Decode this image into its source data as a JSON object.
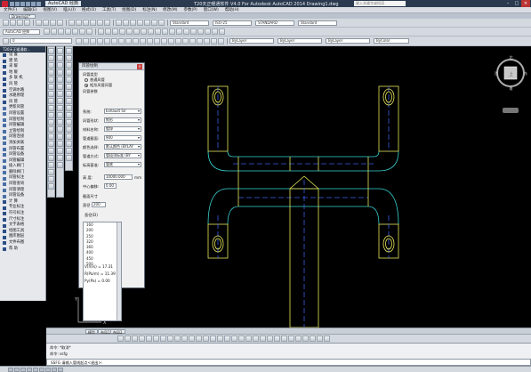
{
  "titlebar": {
    "workspace": "AutoCAD 经典",
    "title": "T20天正暖通软件 V4.0 For Autodesk AutoCAD 2014    Drawing1.dwg",
    "search_placeholder": "键入关键字或短语"
  },
  "menu": [
    "文件(F)",
    "编辑(E)",
    "视图(V)",
    "插入(I)",
    "格式(O)",
    "工具(T)",
    "绘图(D)",
    "标注(N)",
    "修改(M)",
    "参数(P)",
    "窗口(W)",
    "帮助(H)"
  ],
  "file_tab": "Drawing1*",
  "toolbar2": {
    "workspace": "AutoCAD 经典",
    "style1": "Standard",
    "style2": "ISO-25",
    "style3": "STANDARD",
    "style4": "Standard"
  },
  "toolbar3": {
    "layer": "0",
    "color": "ByLayer",
    "linetype": "ByLayer",
    "lineweight": "ByLayer",
    "plotstyle": "ByColor"
  },
  "palette": {
    "title": "T20天正暖通软...",
    "items": [
      {
        "label": "设    置",
        "group": true
      },
      {
        "label": "建    筑",
        "group": true
      },
      {
        "label": "采    暖",
        "group": true
      },
      {
        "label": "地    暖",
        "group": true
      },
      {
        "label": "多 联 机",
        "group": true
      },
      {
        "label": "风    管",
        "group": true
      },
      {
        "label": "空调水路",
        "group": true
      },
      {
        "label": "水路原理",
        "group": true
      },
      {
        "label": "风    管",
        "group": true
      },
      {
        "label": "更新风管",
        "group": false
      },
      {
        "label": "风管设置",
        "group": false
      },
      {
        "label": "风管绘制",
        "group": false
      },
      {
        "label": "风管编辑",
        "group": false
      },
      {
        "label": "立管绘制",
        "group": false
      },
      {
        "label": "风管连接",
        "group": false
      },
      {
        "label": "添加关联",
        "group": false
      },
      {
        "label": "风管布置",
        "group": false
      },
      {
        "label": "风管设备",
        "group": false
      },
      {
        "label": "风管编辑",
        "group": false
      },
      {
        "label": "插入阀门",
        "group": false
      },
      {
        "label": "删除阀门",
        "group": false
      },
      {
        "label": "风管标注",
        "group": false
      },
      {
        "label": "风管查询",
        "group": false
      },
      {
        "label": "风管清理",
        "group": false
      },
      {
        "label": "风管设备",
        "group": false
      },
      {
        "label": "计    算",
        "group": true
      },
      {
        "label": "专业标注",
        "group": true
      },
      {
        "label": "符号标注",
        "group": true
      },
      {
        "label": "尺寸标注",
        "group": true
      },
      {
        "label": "文字表格",
        "group": true
      },
      {
        "label": "绘图工具",
        "group": true
      },
      {
        "label": "图库图层",
        "group": true
      },
      {
        "label": "文件布图",
        "group": true
      },
      {
        "label": "帮    助",
        "group": true
      }
    ]
  },
  "dialog": {
    "title": "风管绘制",
    "section_type": "风管类型",
    "radio1": "普通风管",
    "radio2": "矩形风管风管",
    "section_param": "风管参数",
    "rows": [
      {
        "label": "系统:",
        "value": "Exhaust Sir"
      },
      {
        "label": "风管形状:",
        "value": "矩形"
      },
      {
        "label": "材料名称:",
        "value": "镀锌"
      },
      {
        "label": "管道截面:",
        "value": "900"
      },
      {
        "label": "颜色选择:",
        "value": "默认颜色 (BYLAY"
      },
      {
        "label": "管道方式:",
        "value": "管段顶标准 (BY"
      },
      {
        "label": "标高基准:",
        "value": "管底"
      }
    ],
    "elevation_label": "高    度:",
    "elevation_value": "10000.000",
    "elevation_unit": "mm",
    "offset_label": "中心偏移:",
    "offset_value": "0.00",
    "size_title": "截面尺寸",
    "diameter_label": "直径",
    "diameter_value": "200",
    "list_title": "直径(D)",
    "list": [
      "160",
      "200",
      "250",
      "320",
      "360",
      "400",
      "450",
      "500"
    ],
    "v_label": "V(m/s) = 17.31",
    "r_label": "R(Pa/m) = 11.39",
    "py_label": "Py(Pa) = 0.00"
  },
  "layout_tabs": [
    "模型",
    "布局1",
    "布局2"
  ],
  "command": {
    "line1": "命令: *取消*",
    "line2": "命令: ssfg",
    "input": "SSFG 请输入管线起点<退出>:"
  },
  "status": {
    "coord": "  "
  }
}
